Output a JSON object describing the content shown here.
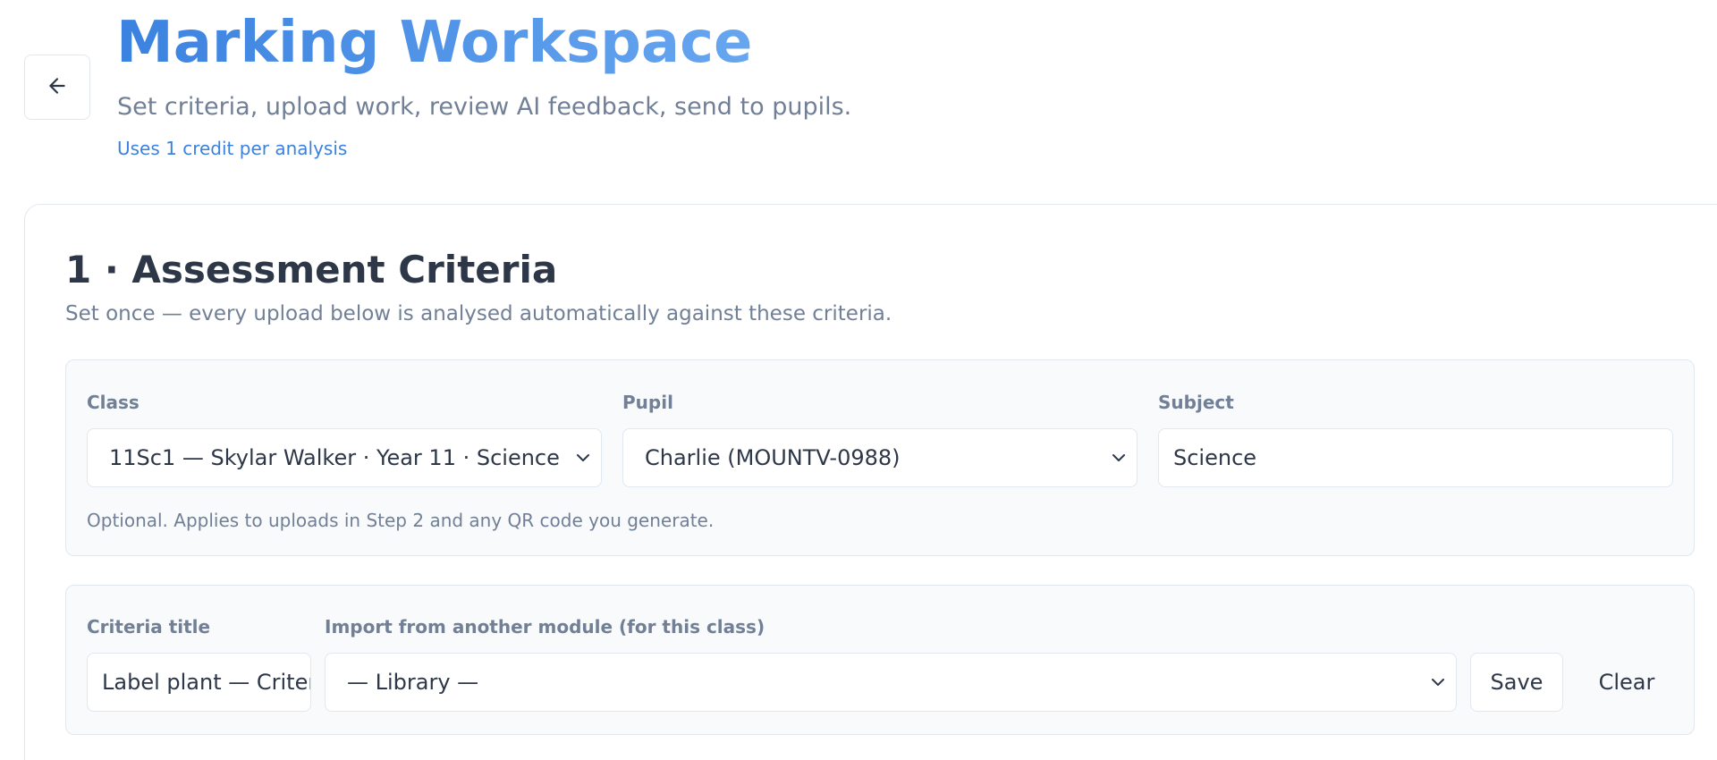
{
  "header": {
    "title": "Marking Workspace",
    "subtitle": "Set criteria, upload work, review AI feedback, send to pupils.",
    "credit_note": "Uses 1 credit per analysis",
    "back_icon": "arrow-left-icon"
  },
  "section": {
    "title": "1 · Assessment Criteria",
    "description": "Set once — every upload below is analysed automatically against these criteria."
  },
  "context_panel": {
    "class_label": "Class",
    "class_value": "11Sc1 — Skylar Walker · Year 11 · Science",
    "pupil_label": "Pupil",
    "pupil_value": "Charlie (MOUNTV-0988)",
    "subject_label": "Subject",
    "subject_value": "Science",
    "help_text": "Optional. Applies to uploads in Step 2 and any QR code you generate."
  },
  "criteria_panel": {
    "title_label": "Criteria title",
    "title_value": "Label plant — Criteria",
    "import_label": "Import from another module (for this class)",
    "import_value": "— Library —",
    "save_label": "Save",
    "clear_label": "Clear"
  },
  "colors": {
    "accent": "#3b82e0",
    "accent_light": "#67a6ef",
    "text": "#2d3748",
    "muted": "#718096",
    "border": "#e2e8f0",
    "panel_bg": "#f8fafc"
  }
}
